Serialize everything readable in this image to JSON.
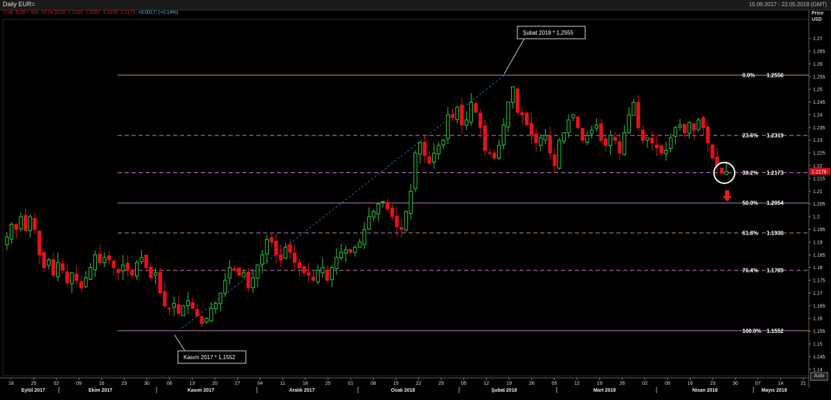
{
  "header": {
    "title": "Daily EUR=",
    "date_range": "15.09.2017 - 22.05.2018 (GMT)",
    "ohlc_label": "Cndl; EUR=; Bid; 26.04.2018; 1.2159; 1.2181; 1.2158; 1.2178;",
    "change_label": "+0.0017; (+0.14%)"
  },
  "price_axis": {
    "title_line1": "Price",
    "title_line2": "USD",
    "current_price": "1.2178",
    "auto_label": "Auto"
  },
  "colors": {
    "up": "#2ecc40",
    "down": "#e8101a",
    "fib": "#c47fc4",
    "background": "#000000"
  },
  "annotations": {
    "high": "Şubat 2018  * 1,2555",
    "low": "Kasım 2017 * 1,1552"
  },
  "chart_data": {
    "type": "candlestick",
    "title": "Daily EUR=",
    "ylabel": "Price USD",
    "ylim": [
      1.1375,
      1.2775
    ],
    "y_ticks": [
      1.14,
      1.145,
      1.15,
      1.155,
      1.16,
      1.165,
      1.17,
      1.175,
      1.18,
      1.185,
      1.19,
      1.195,
      1.2,
      1.205,
      1.21,
      1.215,
      1.22,
      1.225,
      1.23,
      1.235,
      1.24,
      1.245,
      1.25,
      1.255,
      1.26,
      1.265,
      1.27
    ],
    "x_day_labels": [
      "18",
      "25",
      "02",
      "09",
      "16",
      "23",
      "30",
      "06",
      "13",
      "20",
      "27",
      "04",
      "11",
      "18",
      "25",
      "01",
      "08",
      "15",
      "22",
      "29",
      "05",
      "12",
      "19",
      "26",
      "05",
      "12",
      "19",
      "26",
      "02",
      "09",
      "16",
      "23",
      "30",
      "07",
      "14",
      "21"
    ],
    "x_month_labels": [
      "Eylül 2017",
      "Ekim 2017",
      "Kasım 2017",
      "Aralık 2017",
      "Ocak 2018",
      "Şubat 2018",
      "Mart 2018",
      "Nisan 2018",
      "Mayıs 2018"
    ],
    "fibonacci": [
      {
        "label": "0.0%",
        "value": 1.2556,
        "style": "solid"
      },
      {
        "label": "23.6%",
        "value": 1.2319,
        "style": "dashed"
      },
      {
        "label": "38.2%",
        "value": 1.2173,
        "style": "dashed"
      },
      {
        "label": "50.0%",
        "value": 1.2054,
        "style": "solid"
      },
      {
        "label": "61.8%",
        "value": 1.1936,
        "style": "dashed"
      },
      {
        "label": "76.4%",
        "value": 1.1789,
        "style": "dashed"
      },
      {
        "label": "100.0%",
        "value": 1.1552,
        "style": "solid"
      }
    ],
    "fib_value_text": [
      "1.2556",
      "1.2319",
      "1.2173",
      "1.2054",
      "1.1936",
      "1.1789",
      "1.1552"
    ],
    "trendline": {
      "from": {
        "date": "2017-11-07",
        "price": 1.1552
      },
      "to": {
        "date": "2018-02-16",
        "price": 1.2555
      }
    },
    "close_series": [
      1.192,
      1.197,
      1.195,
      1.2,
      1.1945,
      1.2,
      1.195,
      1.185,
      1.18,
      1.183,
      1.177,
      1.182,
      1.179,
      1.174,
      1.178,
      1.175,
      1.172,
      1.176,
      1.18,
      1.185,
      1.182,
      1.184,
      1.183,
      1.18,
      1.178,
      1.181,
      1.179,
      1.177,
      1.182,
      1.184,
      1.18,
      1.176,
      1.178,
      1.17,
      1.165,
      1.164,
      1.166,
      1.162,
      1.165,
      1.167,
      1.164,
      1.161,
      1.158,
      1.16,
      1.164,
      1.166,
      1.17,
      1.175,
      1.18,
      1.179,
      1.177,
      1.178,
      1.172,
      1.176,
      1.181,
      1.185,
      1.191,
      1.19,
      1.185,
      1.183,
      1.188,
      1.186,
      1.182,
      1.18,
      1.178,
      1.177,
      1.175,
      1.179,
      1.18,
      1.175,
      1.18,
      1.184,
      1.186,
      1.187,
      1.186,
      1.188,
      1.19,
      1.195,
      1.2,
      1.202,
      1.205,
      1.206,
      1.203,
      1.2,
      1.196,
      1.195,
      1.202,
      1.21,
      1.225,
      1.229,
      1.224,
      1.221,
      1.225,
      1.228,
      1.23,
      1.24,
      1.239,
      1.243,
      1.236,
      1.238,
      1.245,
      1.241,
      1.235,
      1.226,
      1.225,
      1.223,
      1.228,
      1.236,
      1.245,
      1.251,
      1.241,
      1.24,
      1.236,
      1.232,
      1.229,
      1.231,
      1.232,
      1.225,
      1.22,
      1.23,
      1.233,
      1.238,
      1.24,
      1.235,
      1.23,
      1.232,
      1.234,
      1.236,
      1.23,
      1.228,
      1.232,
      1.23,
      1.225,
      1.233,
      1.24,
      1.245,
      1.235,
      1.23,
      1.231,
      1.229,
      1.227,
      1.225,
      1.226,
      1.231,
      1.235,
      1.236,
      1.233,
      1.237,
      1.234,
      1.238,
      1.235,
      1.229,
      1.223,
      1.22,
      1.217,
      1.2178
    ]
  }
}
